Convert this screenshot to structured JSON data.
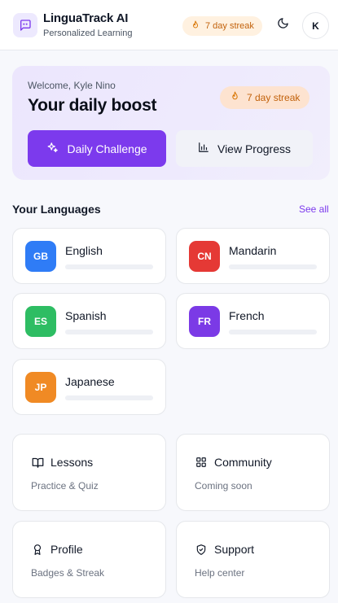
{
  "header": {
    "app_title": "LinguaTrack AI",
    "app_subtitle": "Personalized Learning",
    "streak_label": "7 day streak",
    "avatar_initial": "K"
  },
  "hero": {
    "welcome": "Welcome, Kyle Nino",
    "title": "Your daily boost",
    "streak_label": "7 day streak",
    "primary_button": "Daily Challenge",
    "secondary_button": "View Progress"
  },
  "languages": {
    "section_title": "Your Languages",
    "see_all": "See all",
    "items": [
      {
        "code": "GB",
        "name": "English",
        "color": "#2f7cf6",
        "progress": 0
      },
      {
        "code": "CN",
        "name": "Mandarin",
        "color": "#e53935",
        "progress": 0
      },
      {
        "code": "ES",
        "name": "Spanish",
        "color": "#2ebd63",
        "progress": 0
      },
      {
        "code": "FR",
        "name": "French",
        "color": "#7b3ae6",
        "progress": 0
      },
      {
        "code": "JP",
        "name": "Japanese",
        "color": "#f08a24",
        "progress": 0
      }
    ]
  },
  "tiles": [
    {
      "icon": "book-open-icon",
      "title": "Lessons",
      "subtitle": "Practice & Quiz"
    },
    {
      "icon": "grid-icon",
      "title": "Community",
      "subtitle": "Coming soon"
    },
    {
      "icon": "award-icon",
      "title": "Profile",
      "subtitle": "Badges & Streak"
    },
    {
      "icon": "shield-icon",
      "title": "Support",
      "subtitle": "Help center"
    }
  ],
  "colors": {
    "accent": "#7c3aed",
    "streak_text": "#c2620c",
    "background": "#f7f8fc"
  }
}
